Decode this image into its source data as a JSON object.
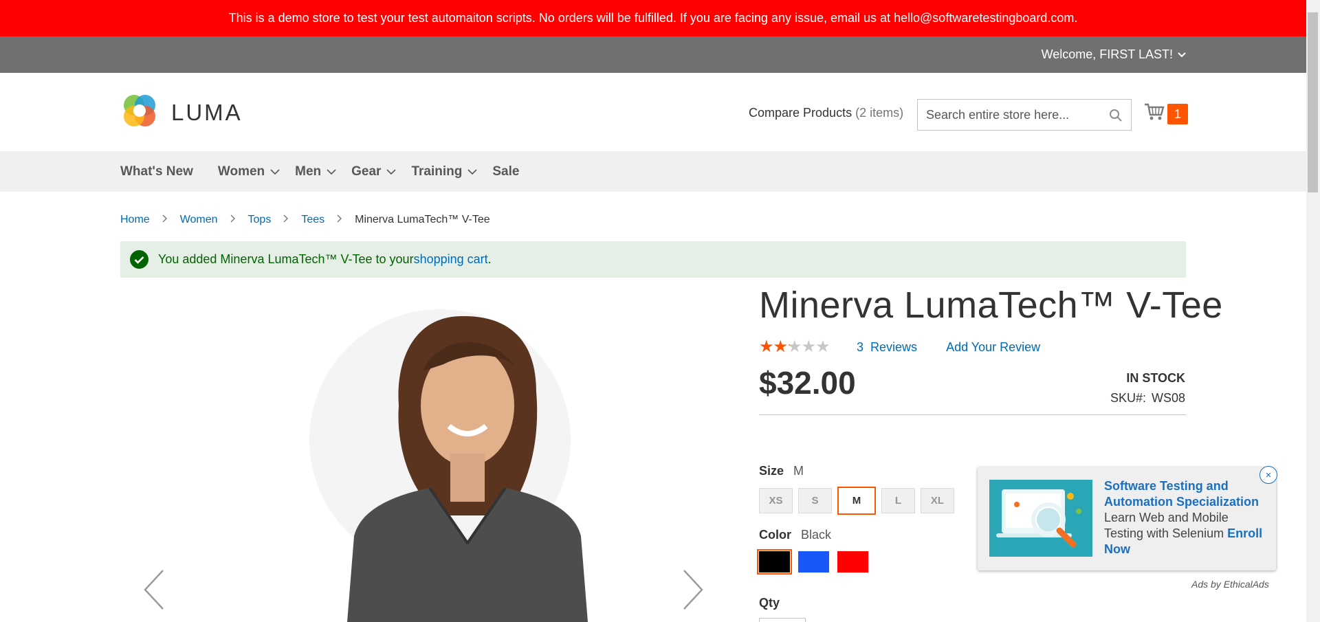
{
  "promo": {
    "text": "This is a demo store to test your test automaiton scripts. No orders will be fulfilled. If you are facing any issue, email us at hello@softwaretestingboard.com."
  },
  "panel": {
    "welcome": "Welcome, FIRST LAST!"
  },
  "header": {
    "logo_text": "LUMA",
    "compare_label": "Compare Products",
    "compare_count": "(2 items)",
    "search_placeholder": "Search entire store here...",
    "cart_count": "1"
  },
  "nav": {
    "items": [
      {
        "label": "What's New"
      },
      {
        "label": "Women"
      },
      {
        "label": "Men"
      },
      {
        "label": "Gear"
      },
      {
        "label": "Training"
      },
      {
        "label": "Sale"
      }
    ]
  },
  "breadcrumbs": [
    "Home",
    "Women",
    "Tops",
    "Tees",
    "Minerva LumaTech™ V-Tee"
  ],
  "message": {
    "prefix": "You added Minerva LumaTech™ V-Tee to your ",
    "link": "shopping cart",
    "suffix": "."
  },
  "product": {
    "title": "Minerva LumaTech™ V-Tee",
    "rating_fraction": 0.4,
    "reviews_count": "3",
    "reviews_label": "Reviews",
    "add_review": "Add Your Review",
    "price": "$32.00",
    "stock": "In stock",
    "sku_label": "SKU#:",
    "sku": "WS08",
    "size_label": "Size",
    "size_selected": "M",
    "sizes": [
      "XS",
      "S",
      "M",
      "L",
      "XL"
    ],
    "color_label": "Color",
    "color_selected": "Black",
    "colors": [
      "#000000",
      "#1857f7",
      "#ff0000"
    ],
    "qty_label": "Qty"
  },
  "ad": {
    "headline": "Software Testing and Automation Specialization",
    "body": "Learn Web and Mobile Testing with Selenium",
    "cta": "Enroll Now",
    "close": "×",
    "by": "Ads by EthicalAds"
  },
  "colors": {
    "promo_bg": "#ff0000",
    "panel_bg": "#6e716e",
    "accent": "#ff5501",
    "link": "#006bb4",
    "success_bg": "#e5efe5"
  }
}
